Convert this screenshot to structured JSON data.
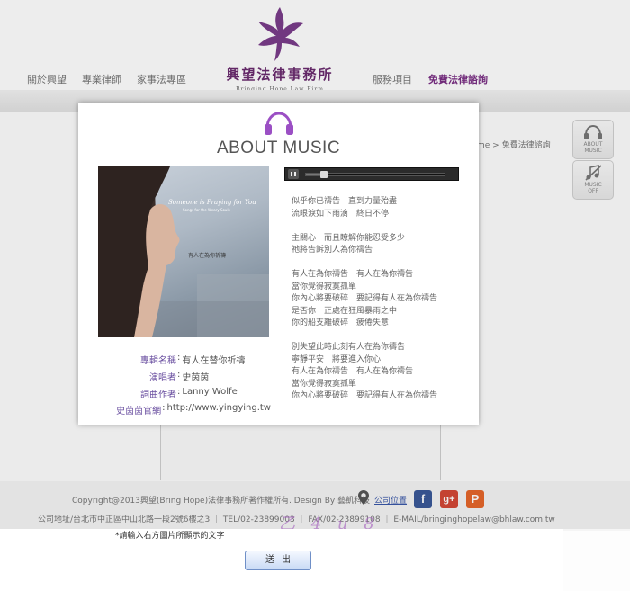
{
  "site": {
    "logo_cn": "興望法律事務所",
    "logo_en": "Bringing Hope Law Firm",
    "nav": [
      "關於興望",
      "專業律師",
      "家事法專區",
      "服務項目",
      "免費法律諮詢"
    ],
    "breadcrumb": "me > 免費法律諮詢"
  },
  "side_buttons": [
    {
      "label_line1": "ABOUT",
      "label_line2": "MUSIC"
    },
    {
      "label_line1": "MUSIC",
      "label_line2": "OFF"
    }
  ],
  "modal": {
    "title": "ABOUT MUSIC",
    "album_caption_title": "Someone is Praying for You",
    "album_caption_sub": "Songs for the Weary Souls",
    "album_caption_cn": "有人在為你祈禱",
    "info": [
      {
        "label": "專輯名稱",
        "value": "有人在替你祈禱"
      },
      {
        "label": "演唱者",
        "value": "史茵茵"
      },
      {
        "label": "詞曲作者",
        "value": "Lanny Wolfe"
      },
      {
        "label": "史茵茵官網",
        "value": "http://www.yingying.tw"
      }
    ],
    "player": {
      "progress": 0.12
    },
    "lyrics": [
      [
        "似乎你已禱告　直到力量殆盡",
        "流眼淚如下雨滴　終日不停"
      ],
      [
        "主關心　而且瞭解你能忍受多少",
        "祂將告訴別人為你禱告"
      ],
      [
        "有人在為你禱告　有人在為你禱告",
        "當你覺得寂寞孤單",
        "你內心將要破碎　要記得有人在為你禱告",
        "是否你　正處在狂風暴雨之中",
        "你的船支離破碎　疲倦失意"
      ],
      [
        "別失望此時此刻有人在為你禱告",
        "寧靜平安　將要進入你心",
        "有人在為你禱告　有人在為你禱告",
        "當你覺得寂寞孤單",
        "你內心將要破碎　要記得有人在為你禱告"
      ]
    ]
  },
  "footer": {
    "copyright": "Copyright@2013興望(Bring Hope)法律事務所著作權所有. Design By 藝凱科技",
    "location_link": "公司位置",
    "address": "公司地址/台北市中正區中山北路一段2號6樓之3 ｜ TEL/02-23899003 ｜ FAX/02-23899108 ｜ E-MAIL/bringinghopelaw@bhlaw.com.tw",
    "captcha": "乙 4 u 8"
  },
  "form": {
    "hint": "*請輸入右方圖片所顯示的文字",
    "submit_label": "送出"
  },
  "colors": {
    "accent": "#7a2f84",
    "title_icon": "#9b4fc4"
  }
}
